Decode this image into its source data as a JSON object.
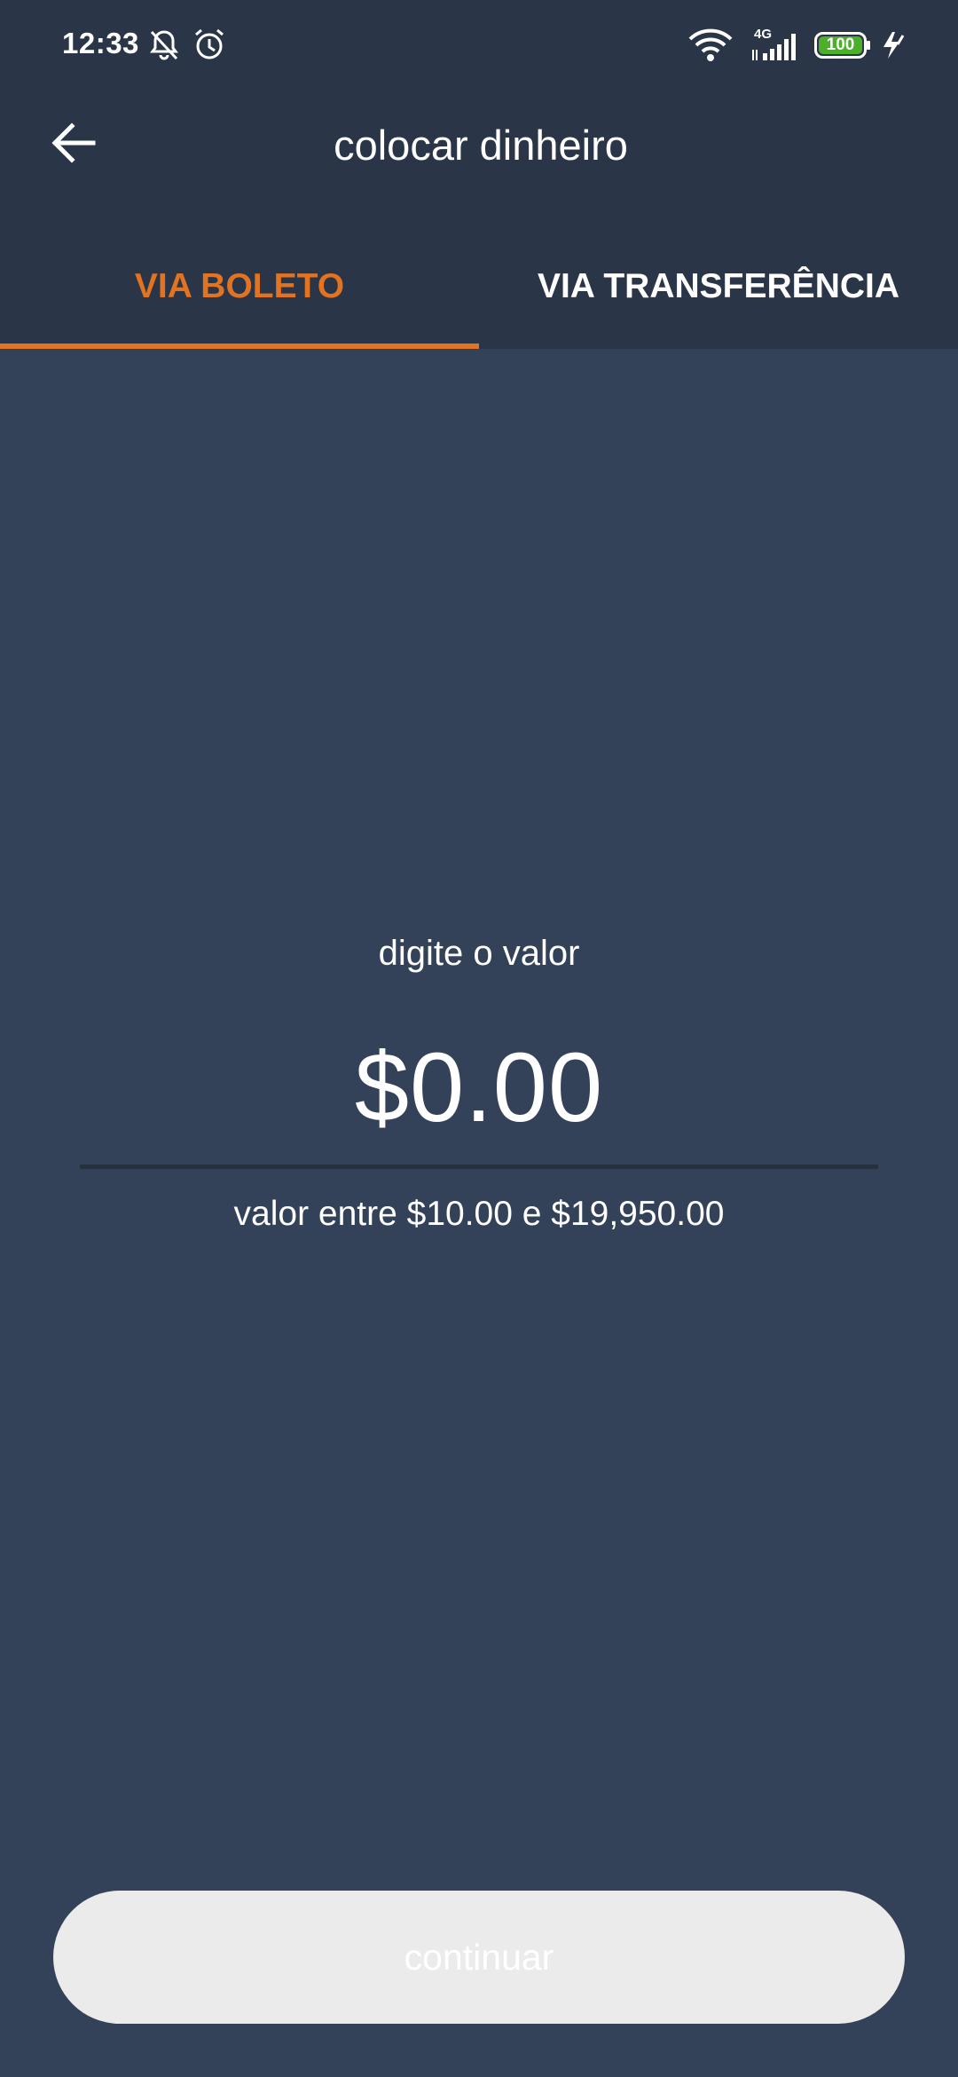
{
  "status_bar": {
    "time": "12:33",
    "network_label": "4G",
    "battery_level": "100",
    "icons": [
      "notifications-muted-icon",
      "alarm-icon",
      "wifi-icon",
      "cellular-signal-icon",
      "battery-icon",
      "charging-icon"
    ]
  },
  "app_bar": {
    "title": "colocar dinheiro",
    "back_icon": "arrow-left-icon"
  },
  "tabs": [
    {
      "label": "VIA BOLETO",
      "selected": true
    },
    {
      "label": "VIA TRANSFERÊNCIA",
      "selected": false
    }
  ],
  "amount": {
    "label": "digite o valor",
    "value": "$0.00",
    "range_hint": "valor entre $10.00 e $19,950.00"
  },
  "continue_button": {
    "label": "continuar",
    "enabled": false
  },
  "colors": {
    "accent": "#e27320",
    "header_bg": "#2a3548",
    "body_bg": "#334259",
    "button_disabled_bg": "#ebebeb",
    "battery_fill": "#4caf2a"
  }
}
